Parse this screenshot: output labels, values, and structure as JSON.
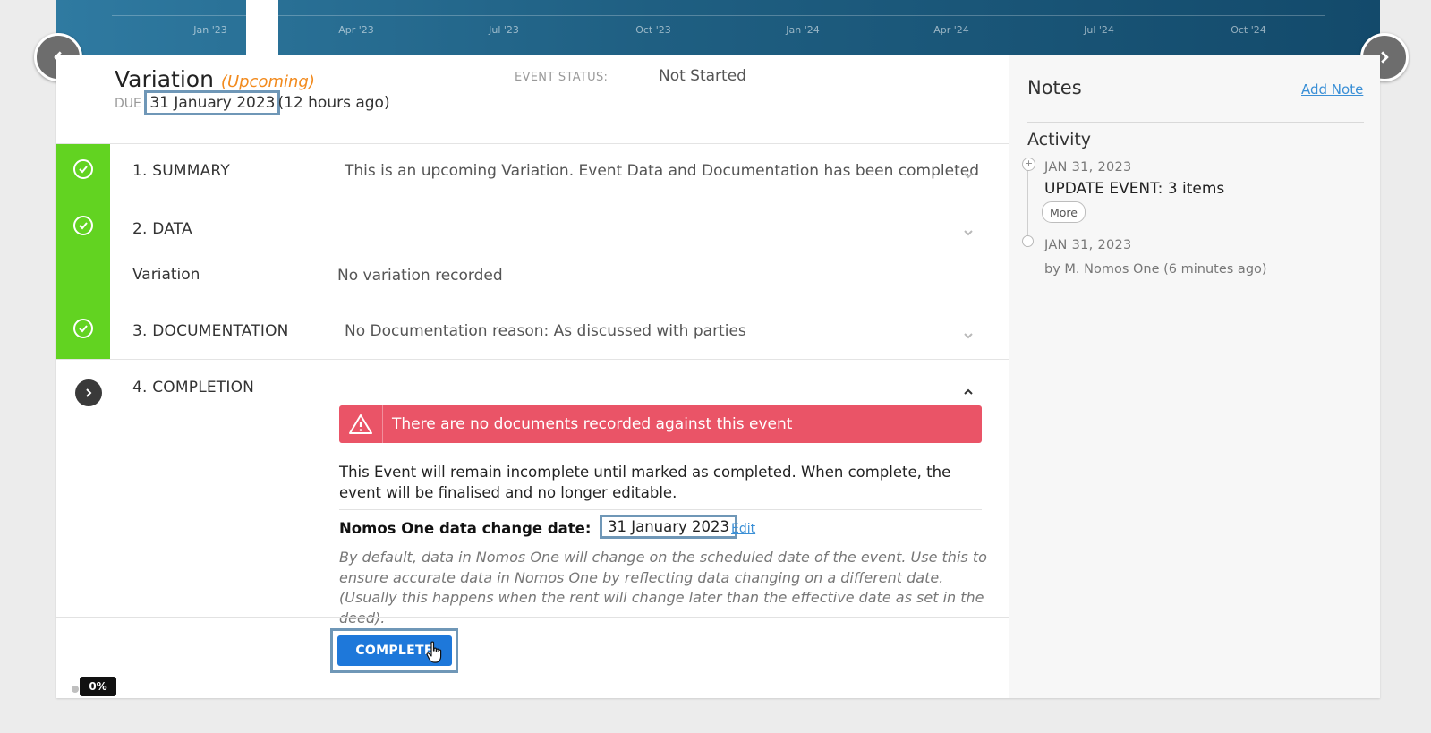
{
  "timeline": {
    "ticks": [
      "Jan '23",
      "Apr '23",
      "Jul '23",
      "Oct '23",
      "Jan '24",
      "Apr '24",
      "Jul '24",
      "Oct '24"
    ]
  },
  "header": {
    "title": "Variation",
    "status_tag": "(Upcoming)",
    "due_label": "DUE",
    "due_date": "31 January 2023",
    "due_relative": "(12 hours ago)",
    "event_status_label": "EVENT STATUS:",
    "event_status_value": "Not Started"
  },
  "sections": {
    "summary": {
      "title": "1. SUMMARY",
      "text": "This is an upcoming Variation. Event Data and Documentation has been completed"
    },
    "data": {
      "title": "2. DATA",
      "field_label": "Variation",
      "field_value": "No variation recorded"
    },
    "documentation": {
      "title": "3. DOCUMENTATION",
      "text": "No Documentation reason: As discussed with parties"
    },
    "completion": {
      "title": "4. COMPLETION",
      "alert": "There are no documents recorded against this event",
      "description": "This Event will remain incomplete until marked as completed. When complete, the event will be finalised and no longer editable.",
      "change_date_label": "Nomos One data change date:",
      "change_date_value": "31 January 2023",
      "edit_label": "Edit",
      "help_text": "By default, data in Nomos One will change on the scheduled date of the event. Use this to ensure accurate data in Nomos One by reflecting data changing on a different date. (Usually this happens when the rent will change later than the effective date as set in the deed).",
      "complete_label": "COMPLETE"
    }
  },
  "progress": {
    "label": "0%"
  },
  "notes": {
    "title": "Notes",
    "add_label": "Add Note",
    "activity_title": "Activity",
    "items": [
      {
        "date": "JAN 31, 2023",
        "event": "UPDATE EVENT: 3 items",
        "more_label": "More"
      },
      {
        "date": "JAN 31, 2023",
        "by": "by M. Nomos One (6 minutes ago)"
      }
    ]
  },
  "colors": {
    "done_green": "#62d321",
    "accent_blue": "#1e78da",
    "alert_red": "#ea5467",
    "upcoming_orange": "#f28a1d"
  }
}
